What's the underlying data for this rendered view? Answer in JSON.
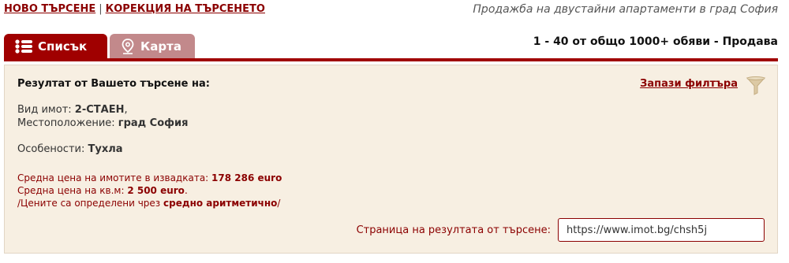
{
  "nav": {
    "new_search": "НОВО ТЪРСЕНЕ",
    "separator": "|",
    "edit_search": "КОРЕКЦИЯ НА ТЪРСЕНЕТО"
  },
  "page_heading": "Продажба на двустайни апартаменти в град София",
  "tabs": [
    {
      "label": "Списък",
      "icon": "list-icon",
      "active": true
    },
    {
      "label": "Карта",
      "icon": "map-pin-icon",
      "active": false
    }
  ],
  "results_count": "1 - 40 от общо 1000+ обяви - Продава",
  "panel": {
    "title": "Резултат от Вашето търсене на:",
    "save_filters": "Запази филтъра",
    "save_icon": "funnel-icon",
    "criteria": {
      "type_label": "Вид имот:",
      "type_value": "2-СТАЕН",
      "type_suffix": ",",
      "location_label": "Местоположение:",
      "location_value": "град София",
      "features_label": "Особености:",
      "features_value": "Тухла"
    },
    "prices": {
      "avg_price_label": "Средна цена на имотите в извадката:",
      "avg_price_value": "178 286 euro",
      "avg_sqm_label": "Средна цена на кв.м:",
      "avg_sqm_value": "2 500 euro",
      "avg_sqm_suffix": ".",
      "note_prefix": "/Цените са определени чрез",
      "note_bold": "средно аритметично",
      "note_suffix": "/"
    },
    "url_label": "Страница на резултата от търсене:",
    "url_value": "https://www.imot.bg/chsh5j"
  },
  "colors": {
    "accent": "#a00000",
    "inactive_tab": "#c2898b",
    "panel_bg": "#f7efe2",
    "link": "#8b0000"
  }
}
